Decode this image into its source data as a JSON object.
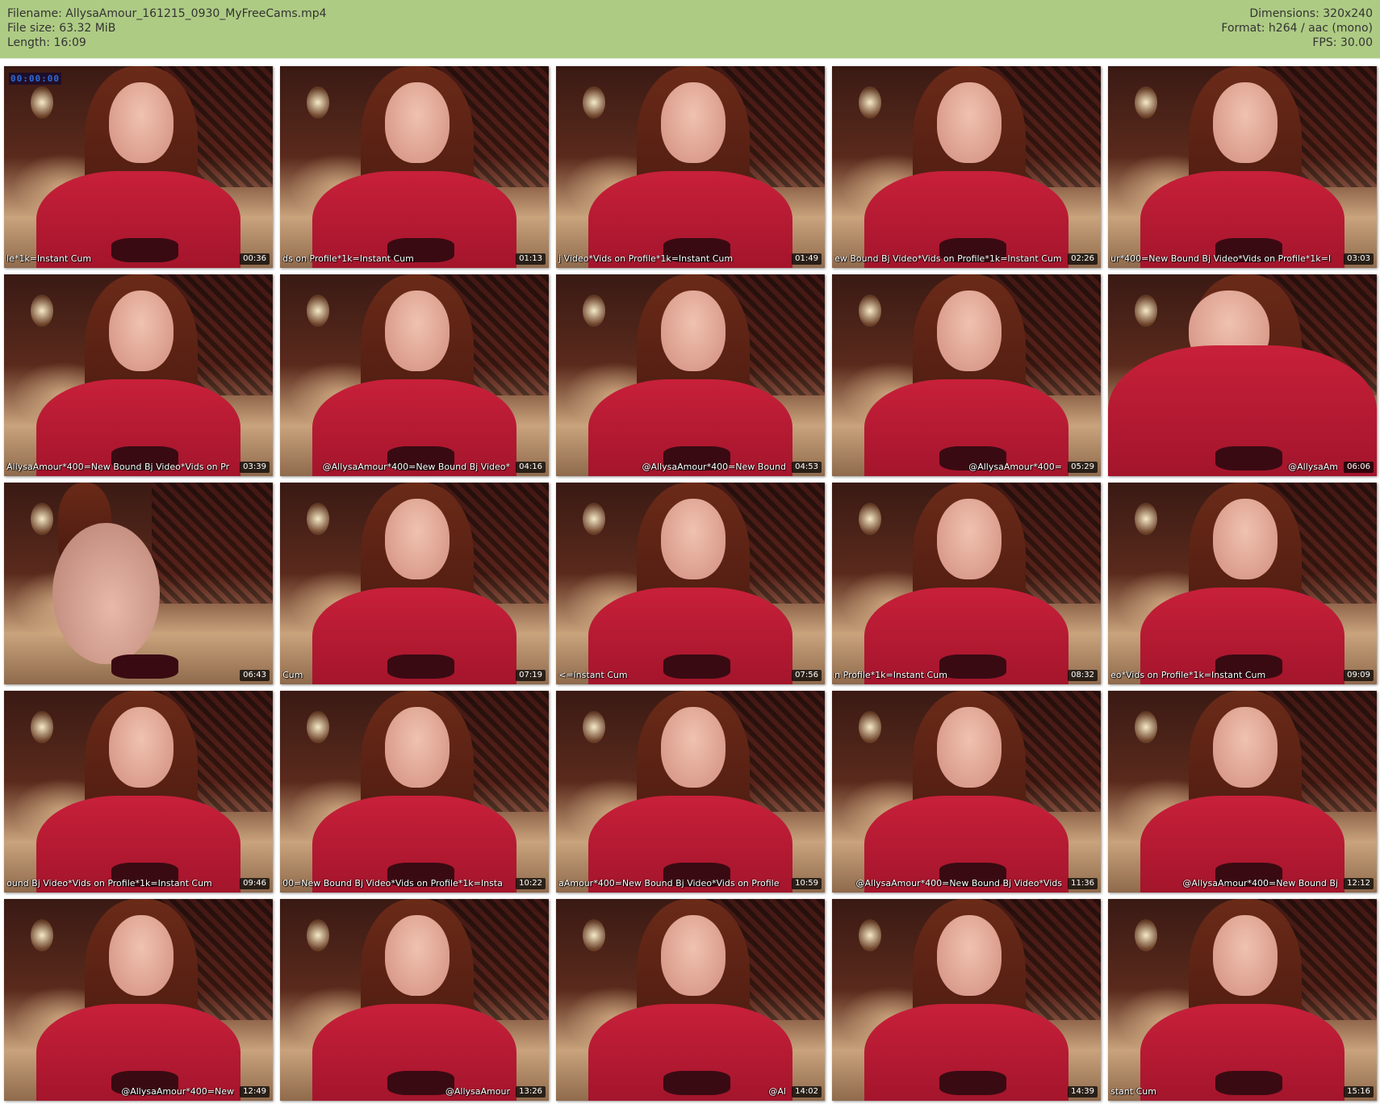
{
  "header": {
    "filename": "Filename: AllysaAmour_161215_0930_MyFreeCams.mp4",
    "filesize": "File size: 63.32 MiB",
    "length": "Length: 16:09",
    "dimensions": "Dimensions: 320x240",
    "format": "Format: h264 / aac (mono)",
    "fps": "FPS: 30.00"
  },
  "overlay": {
    "clock": "00:00:00"
  },
  "thumbnails": [
    {
      "timestamp": "00:36",
      "caption": "le*1k=Instant Cum",
      "align": "left",
      "variant": "std"
    },
    {
      "timestamp": "01:13",
      "caption": "ds on Profile*1k=Instant Cum",
      "align": "left",
      "variant": "std"
    },
    {
      "timestamp": "01:49",
      "caption": "j Video*Vids on Profile*1k=Instant Cum",
      "align": "left",
      "variant": "std"
    },
    {
      "timestamp": "02:26",
      "caption": "ew Bound Bj Video*Vids on Profile*1k=Instant Cum",
      "align": "left",
      "variant": "std"
    },
    {
      "timestamp": "03:03",
      "caption": "ur*400=New Bound Bj Video*Vids on Profile*1k=I",
      "align": "left",
      "variant": "std"
    },
    {
      "timestamp": "03:39",
      "caption": "AllysaAmour*400=New Bound Bj Video*Vids on Pr",
      "align": "left",
      "variant": "std"
    },
    {
      "timestamp": "04:16",
      "caption": "@AllysaAmour*400=New Bound Bj Video*",
      "align": "right",
      "variant": "std"
    },
    {
      "timestamp": "04:53",
      "caption": "@AllysaAmour*400=New Bound",
      "align": "right",
      "variant": "std"
    },
    {
      "timestamp": "05:29",
      "caption": "@AllysaAmour*400=",
      "align": "right",
      "variant": "std"
    },
    {
      "timestamp": "06:06",
      "caption": "@AllysaAm",
      "align": "right",
      "variant": "close"
    },
    {
      "timestamp": "06:43",
      "caption": "",
      "align": "left",
      "variant": "alt"
    },
    {
      "timestamp": "07:19",
      "caption": "Cum",
      "align": "left",
      "variant": "std"
    },
    {
      "timestamp": "07:56",
      "caption": "<=Instant Cum",
      "align": "left",
      "variant": "std"
    },
    {
      "timestamp": "08:32",
      "caption": "n Profile*1k=Instant Cum",
      "align": "left",
      "variant": "std"
    },
    {
      "timestamp": "09:09",
      "caption": "eo*Vids on Profile*1k=Instant Cum",
      "align": "left",
      "variant": "std"
    },
    {
      "timestamp": "09:46",
      "caption": "ound Bj Video*Vids on Profile*1k=Instant Cum",
      "align": "left",
      "variant": "std"
    },
    {
      "timestamp": "10:22",
      "caption": "00=New Bound Bj Video*Vids on Profile*1k=Insta",
      "align": "left",
      "variant": "std"
    },
    {
      "timestamp": "10:59",
      "caption": "aAmour*400=New Bound Bj Video*Vids on Profile",
      "align": "left",
      "variant": "std"
    },
    {
      "timestamp": "11:36",
      "caption": "@AllysaAmour*400=New Bound Bj Video*Vids",
      "align": "right",
      "variant": "std"
    },
    {
      "timestamp": "12:12",
      "caption": "@AllysaAmour*400=New Bound Bj",
      "align": "right",
      "variant": "std"
    },
    {
      "timestamp": "12:49",
      "caption": "@AllysaAmour*400=New",
      "align": "right",
      "variant": "std"
    },
    {
      "timestamp": "13:26",
      "caption": "@AllysaAmour",
      "align": "right",
      "variant": "std"
    },
    {
      "timestamp": "14:02",
      "caption": "@Al",
      "align": "right",
      "variant": "std"
    },
    {
      "timestamp": "14:39",
      "caption": "",
      "align": "left",
      "variant": "std"
    },
    {
      "timestamp": "15:16",
      "caption": "stant Cum",
      "align": "left",
      "variant": "std"
    }
  ]
}
